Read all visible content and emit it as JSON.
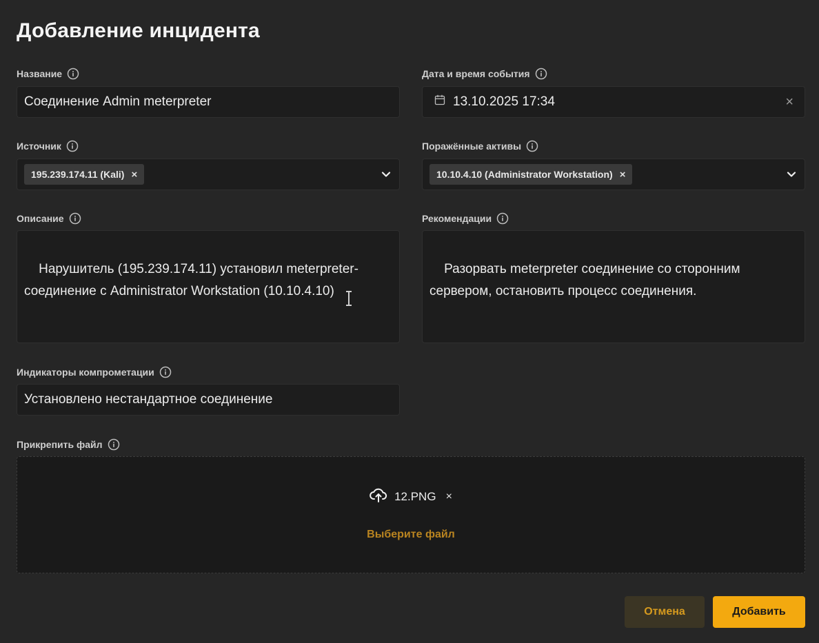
{
  "dialog": {
    "title": "Добавление инцидента"
  },
  "fields": {
    "name": {
      "label": "Название",
      "value": "Соединение Admin meterpreter"
    },
    "datetime": {
      "label": "Дата и время события",
      "value": "13.10.2025 17:34"
    },
    "source": {
      "label": "Источник",
      "tag": "195.239.174.11 (Kali)"
    },
    "assets": {
      "label": "Поражённые активы",
      "tag": "10.10.4.10 (Administrator Workstation)"
    },
    "description": {
      "label": "Описание",
      "value": "Нарушитель (195.239.174.11) установил meterpreter-\nсоединение с Administrator Workstation (10.10.4.10)"
    },
    "recommendations": {
      "label": "Рекомендации",
      "value": "Разорвать meterpreter соединение со сторонним\nсервером, остановить процесс соединения."
    },
    "ioc": {
      "label": "Индикаторы компрометации",
      "value": "Установлено нестандартное соединение"
    },
    "attach": {
      "label": "Прикрепить файл",
      "file_name": "12.PNG",
      "choose_label": "Выберите файл"
    }
  },
  "icons": {
    "info": "info-icon",
    "calendar": "calendar-icon",
    "clear": "×",
    "remove": "×",
    "chevron": "chevron-down-icon",
    "upload": "cloud-upload-icon"
  },
  "buttons": {
    "cancel": "Отмена",
    "add": "Добавить"
  },
  "colors": {
    "accent": "#f3a90f",
    "accent_text": "#d69a1e",
    "link": "#b98420"
  }
}
